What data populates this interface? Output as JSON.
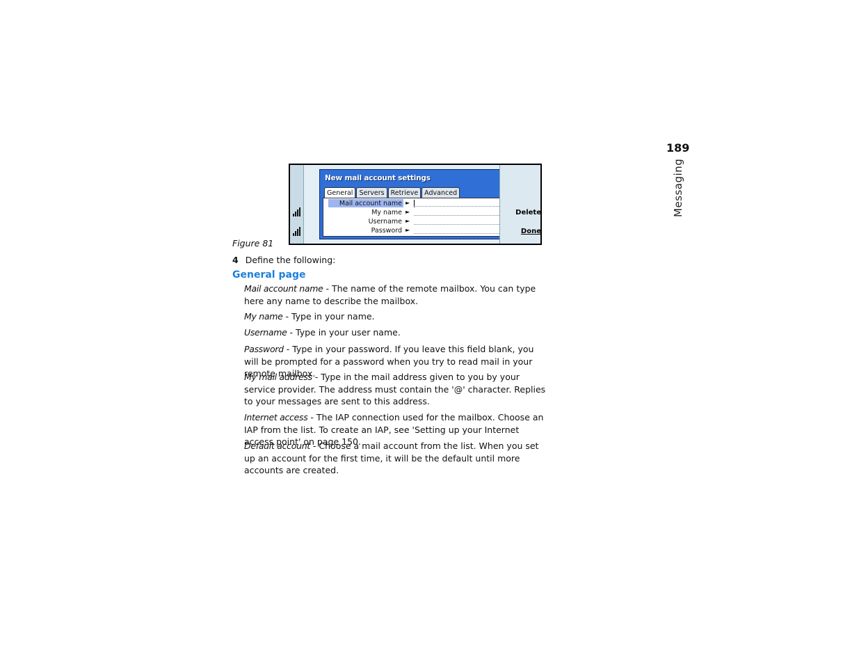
{
  "page": {
    "number": "189",
    "section": "Messaging"
  },
  "figure": {
    "caption": "Figure 81",
    "dialog_title": "New mail account settings",
    "tabs": [
      "General",
      "Servers",
      "Retrieve",
      "Advanced"
    ],
    "fields": [
      "Mail account name",
      "My name",
      "Username",
      "Password"
    ],
    "commands": {
      "delete": "Delete",
      "done": "Done"
    }
  },
  "step": {
    "number": "4",
    "text": "Define the following:"
  },
  "section_heading": "General page",
  "definitions": [
    {
      "term": "Mail account name",
      "text": " - The name of the remote mailbox. You can type here any name to describe the mailbox."
    },
    {
      "term": "My name",
      "text": " - Type in your name."
    },
    {
      "term": "Username",
      "text": " - Type in your user name."
    },
    {
      "term": "Password",
      "text": " - Type in your password. If you leave this field blank, you will be prompted for a password when you try to read mail in your remote mailbox."
    },
    {
      "term": "My mail address",
      "text": " - Type in the mail address given to you by your service provider. The address must contain the '@' character. Replies to your messages are sent to this address."
    },
    {
      "term": "Internet access",
      "text": " - The IAP connection used for the mailbox. Choose an IAP from the list. To create an IAP, see 'Setting up your Internet access point' on page 150."
    },
    {
      "term": "Default account",
      "text": " - Choose a mail account from the list. When you set up an account for the first time, it will be the default until more accounts are created."
    }
  ]
}
